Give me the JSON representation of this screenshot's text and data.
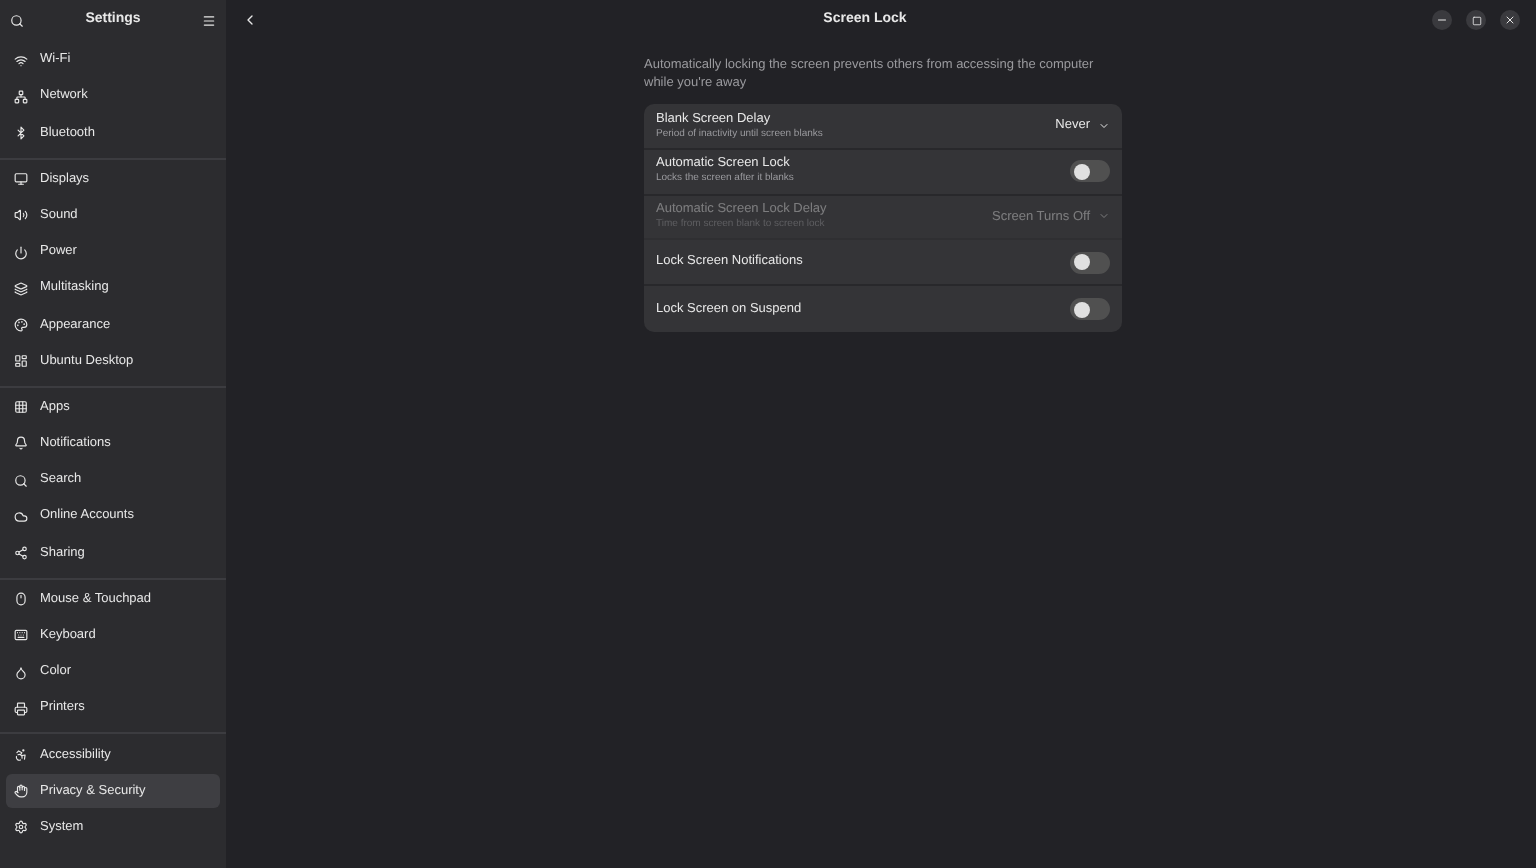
{
  "sidebar": {
    "title": "Settings",
    "groups": [
      [
        {
          "label": "Wi-Fi",
          "selected": false
        },
        {
          "label": "Network",
          "selected": false
        },
        {
          "label": "Bluetooth",
          "selected": false
        }
      ],
      [
        {
          "label": "Displays",
          "selected": false
        },
        {
          "label": "Sound",
          "selected": false
        },
        {
          "label": "Power",
          "selected": false
        },
        {
          "label": "Multitasking",
          "selected": false
        },
        {
          "label": "Appearance",
          "selected": false
        },
        {
          "label": "Ubuntu Desktop",
          "selected": false
        }
      ],
      [
        {
          "label": "Apps",
          "selected": false
        },
        {
          "label": "Notifications",
          "selected": false
        },
        {
          "label": "Search",
          "selected": false
        },
        {
          "label": "Online Accounts",
          "selected": false
        },
        {
          "label": "Sharing",
          "selected": false
        }
      ],
      [
        {
          "label": "Mouse & Touchpad",
          "selected": false
        },
        {
          "label": "Keyboard",
          "selected": false
        },
        {
          "label": "Color",
          "selected": false
        },
        {
          "label": "Printers",
          "selected": false
        }
      ],
      [
        {
          "label": "Accessibility",
          "selected": false
        },
        {
          "label": "Privacy & Security",
          "selected": true
        },
        {
          "label": "System",
          "selected": false
        }
      ]
    ]
  },
  "page": {
    "title": "Screen Lock",
    "description": "Automatically locking the screen prevents others from accessing the computer while you're away",
    "rows": [
      {
        "kind": "dropdown",
        "title": "Blank Screen Delay",
        "subtitle": "Period of inactivity until screen blanks",
        "value": "Never",
        "disabled": false
      },
      {
        "kind": "toggle",
        "title": "Automatic Screen Lock",
        "subtitle": "Locks the screen after it blanks",
        "on": false,
        "disabled": false
      },
      {
        "kind": "dropdown",
        "title": "Automatic Screen Lock Delay",
        "subtitle": "Time from screen blank to screen lock",
        "value": "Screen Turns Off",
        "disabled": true
      },
      {
        "kind": "toggle",
        "title": "Lock Screen Notifications",
        "on": false,
        "disabled": false
      },
      {
        "kind": "toggle",
        "title": "Lock Screen on Suspend",
        "on": false,
        "disabled": false
      }
    ]
  }
}
